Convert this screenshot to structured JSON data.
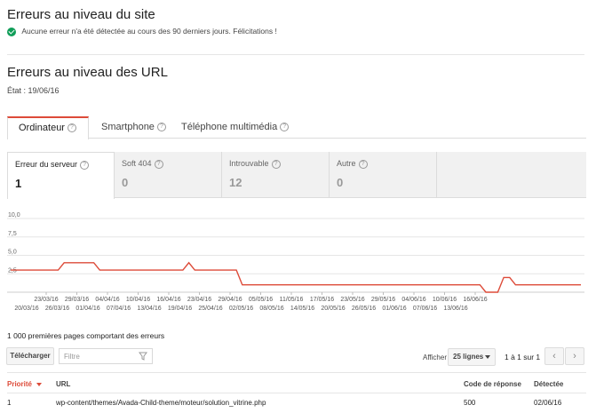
{
  "site": {
    "title": "Erreurs au niveau du site",
    "status": "Aucune erreur n'a été détectée au cours des 90 derniers jours. Félicitations !"
  },
  "url_errors": {
    "title": "Erreurs au niveau des URL",
    "state": "État : 19/06/16"
  },
  "tabs": [
    {
      "label": "Ordinateur",
      "active": true
    },
    {
      "label": "Smartphone",
      "active": false
    },
    {
      "label": "Téléphone multimédia",
      "active": false
    }
  ],
  "cards": [
    {
      "label": "Erreur du serveur",
      "value": "1",
      "active": true
    },
    {
      "label": "Soft 404",
      "value": "0",
      "active": false
    },
    {
      "label": "Introuvable",
      "value": "12",
      "active": false
    },
    {
      "label": "Autre",
      "value": "0",
      "active": false
    }
  ],
  "chart_data": {
    "type": "line",
    "yticks": [
      "10,0",
      "7,5",
      "5,0",
      "2,5"
    ],
    "ylim": [
      0,
      10
    ],
    "xticks_top": [
      "23/03/16",
      "29/03/16",
      "04/04/16",
      "10/04/16",
      "16/04/16",
      "23/04/16",
      "29/04/16",
      "05/05/16",
      "11/05/16",
      "17/05/16",
      "23/05/16",
      "29/05/16",
      "04/06/16",
      "10/06/16",
      "16/06/16"
    ],
    "xticks_bottom": [
      "20/03/16",
      "26/03/16",
      "01/04/16",
      "07/04/16",
      "13/04/16",
      "19/04/16",
      "25/04/16",
      "02/05/16",
      "08/05/16",
      "14/05/16",
      "20/05/16",
      "26/05/16",
      "01/06/16",
      "07/06/16",
      "13/06/16"
    ],
    "series": [
      {
        "color": "#dd4b39",
        "values": [
          3,
          3,
          3,
          3,
          3,
          3,
          3,
          3,
          3,
          4,
          4,
          4,
          4,
          4,
          4,
          3,
          3,
          3,
          3,
          3,
          3,
          3,
          3,
          3,
          3,
          3,
          3,
          3,
          3,
          3,
          4,
          3,
          3,
          3,
          3,
          3,
          3,
          3,
          3,
          1,
          1,
          1,
          1,
          1,
          1,
          1,
          1,
          1,
          1,
          1,
          1,
          1,
          1,
          1,
          1,
          1,
          1,
          1,
          1,
          1,
          1,
          1,
          1,
          1,
          1,
          1,
          1,
          1,
          1,
          1,
          1,
          1,
          1,
          1,
          1,
          1,
          1,
          1,
          1,
          1,
          0,
          0,
          0,
          2,
          2,
          1,
          1,
          1,
          1,
          1,
          1,
          1,
          1,
          1,
          1,
          1,
          1
        ]
      }
    ]
  },
  "table": {
    "count_label": "1 000 premières pages comportant des erreurs",
    "download": "Télécharger",
    "filter_placeholder": "Filtre",
    "show_label": "Afficher",
    "rows_select": "25 lignes",
    "pagination": "1 à 1 sur 1",
    "headers": [
      "Priorité",
      "URL",
      "Code de réponse",
      "Détectée"
    ],
    "rows": [
      {
        "priority": "1",
        "url": "wp-content/themes/Avada-Child-theme/moteur/solution_vitrine.php",
        "code": "500",
        "detected": "02/06/16"
      }
    ]
  }
}
